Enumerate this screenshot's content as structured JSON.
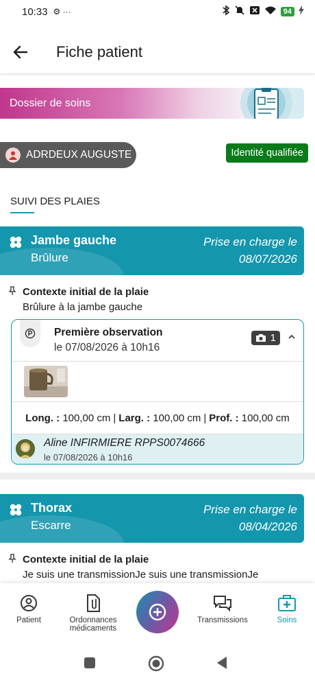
{
  "status_bar": {
    "time": "10:33",
    "extra": "⚙ ···",
    "battery": "94"
  },
  "app_bar": {
    "title": "Fiche patient"
  },
  "banner": {
    "label": "Dossier de soins"
  },
  "patient": {
    "name": "ADRDEUX AUGUSTE",
    "identity_badge": "Identité qualifiée"
  },
  "section": {
    "title": "SUIVI DES PLAIES"
  },
  "wounds": [
    {
      "location": "Jambe gauche",
      "type": "Brûlure",
      "care_label": "Prise en charge le",
      "care_date": "08/07/2026",
      "context_title": "Contexte initial de la plaie",
      "context_text": "Brûlure à la jambe gauche",
      "observation": {
        "title": "Première observation",
        "date": "le 07/08/2026 à 10h16",
        "photo_count": "1",
        "measures": {
          "long_label": "Long. :",
          "long_value": "100,00 cm",
          "larg_label": "Larg. :",
          "larg_value": "100,00 cm",
          "prof_label": "Prof. :",
          "prof_value": "100,00 cm"
        },
        "author": "Aline INFIRMIERE RPPS0074666",
        "author_date": "le 07/08/2026 à 10h16"
      }
    },
    {
      "location": "Thorax",
      "type": "Escarre",
      "care_label": "Prise en charge le",
      "care_date": "08/04/2026",
      "context_title": "Contexte initial de la plaie",
      "context_text": "Je suis une transmissionJe suis une transmissionJe"
    }
  ],
  "bottom_nav": {
    "patient": "Patient",
    "ordonnances_line1": "Ordonnances",
    "ordonnances_line2": "médicaments",
    "transmissions": "Transmissions",
    "soins": "Soins"
  },
  "colors": {
    "accent": "#1598ad",
    "banner_pink": "#c0368c",
    "badge_green": "#0a7a1a"
  }
}
